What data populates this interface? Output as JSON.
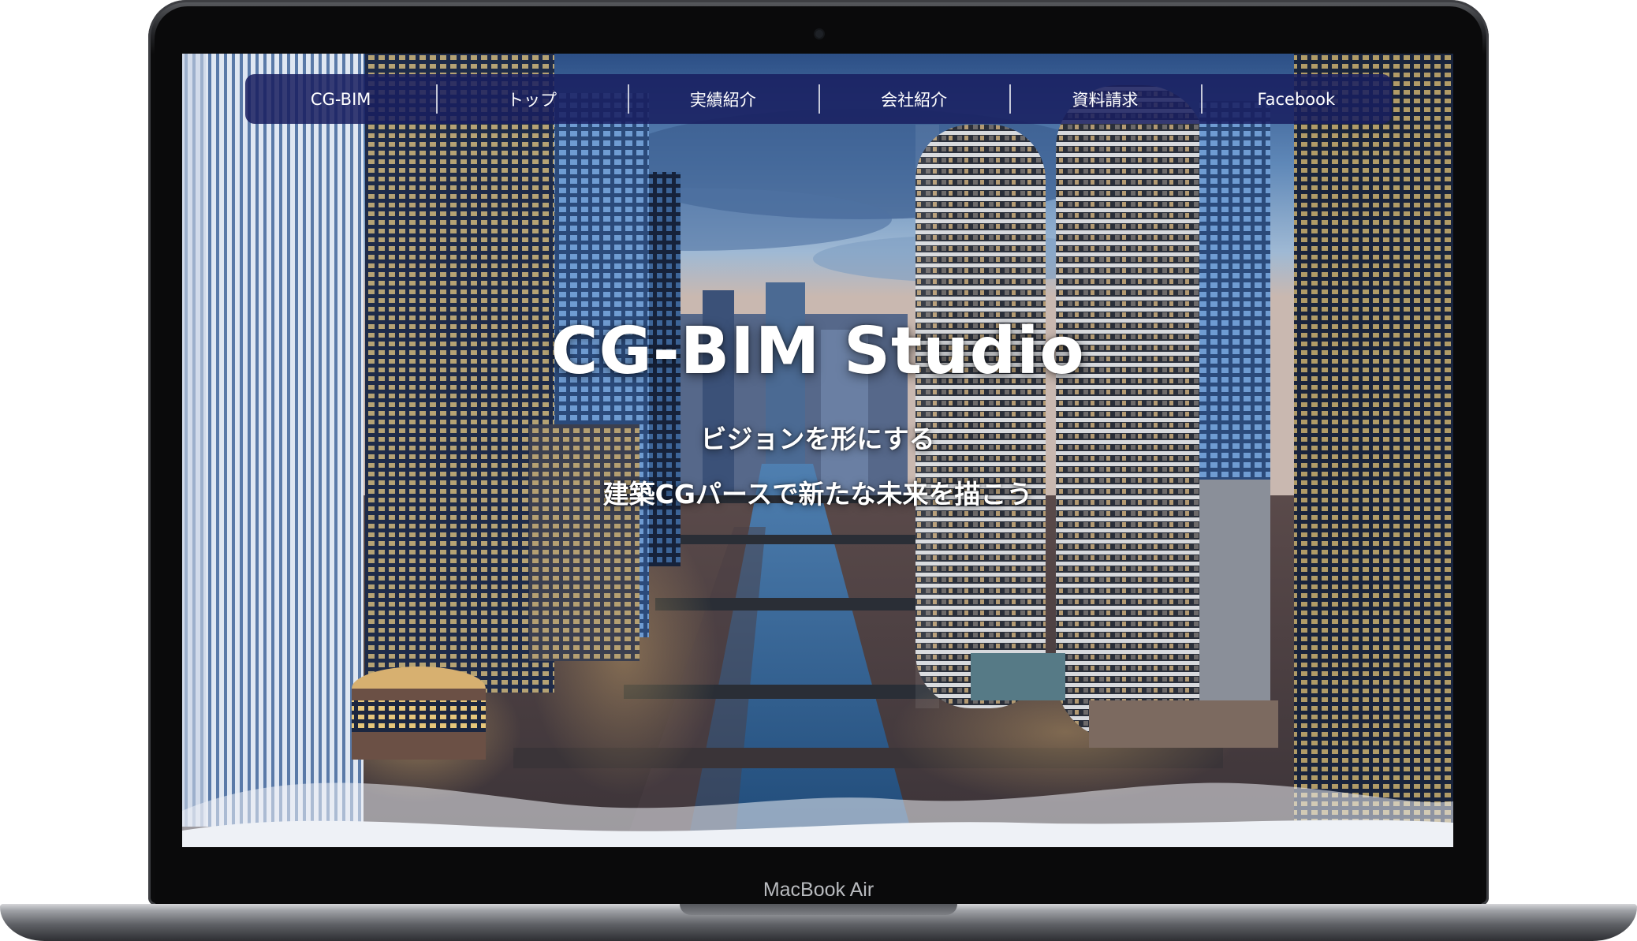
{
  "device": {
    "label": "MacBook Air"
  },
  "site": {
    "nav": [
      "CG-BIM",
      "トップ",
      "実績紹介",
      "会社紹介",
      "資料請求",
      "Facebook"
    ],
    "hero": {
      "title": "CG-BIM Studio",
      "tagline_1": "ビジョンを形にする",
      "tagline_2": "建築CGパースで新たな未来を描こう"
    }
  },
  "colors": {
    "nav_background": "#181e60",
    "wave": "#eef1f6",
    "sky": "#5f88b8"
  }
}
